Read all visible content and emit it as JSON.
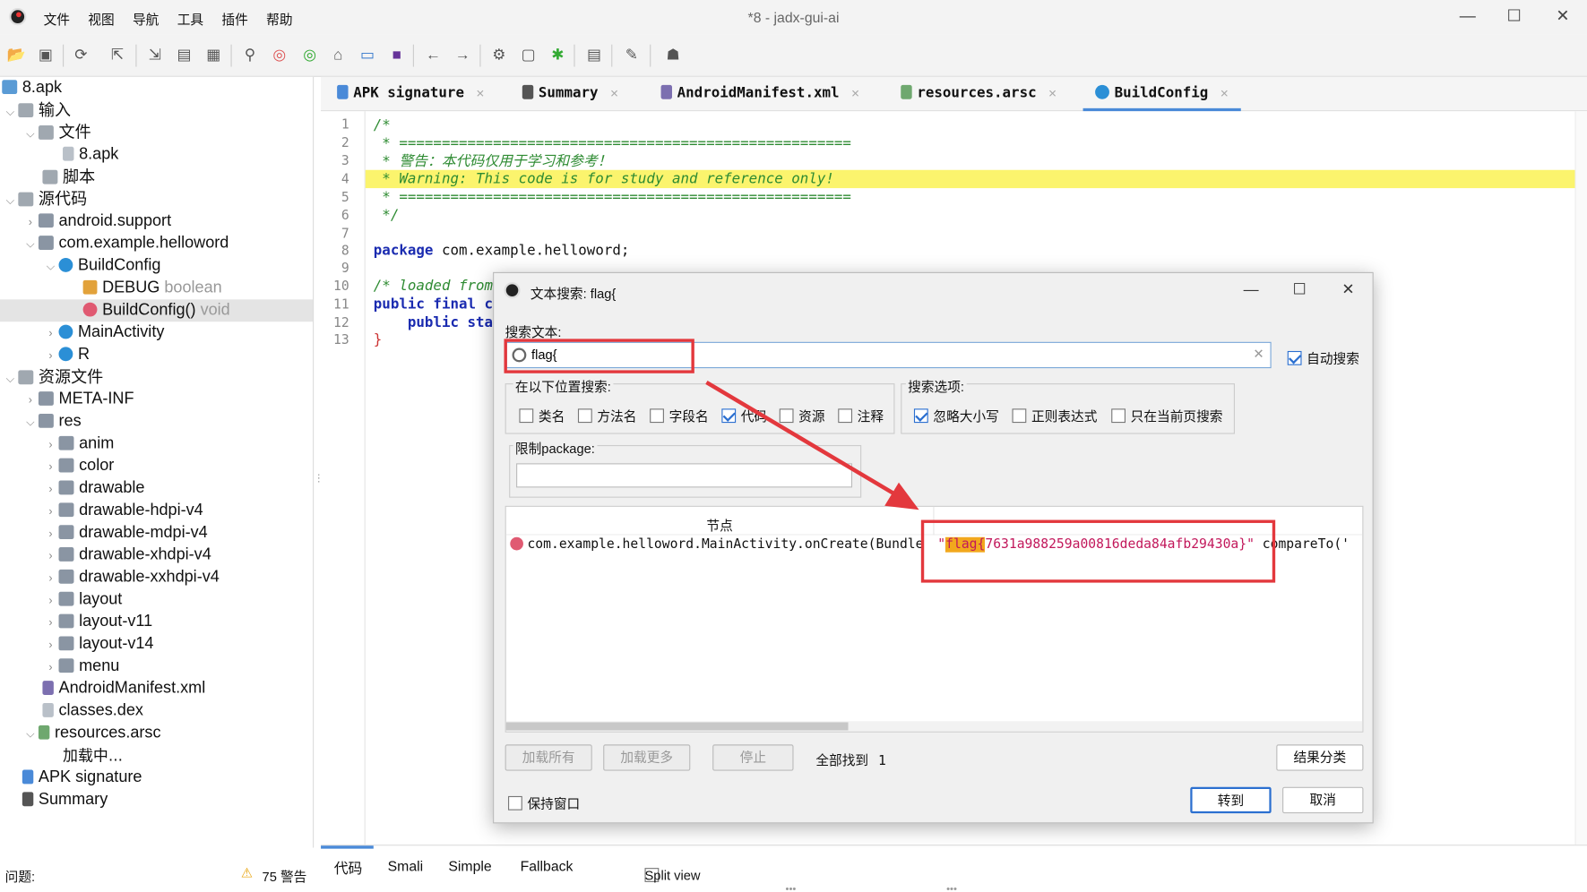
{
  "menu": [
    "文件",
    "视图",
    "导航",
    "工具",
    "插件",
    "帮助"
  ],
  "window": {
    "title": "*8 - jadx-gui-ai",
    "minimize": "—",
    "maximize": "☐",
    "close": "✕"
  },
  "toolbar_icons": [
    "open-file-icon",
    "add-file-icon",
    "reload-icon",
    "export-icon",
    "sync-icon",
    "flatten-icon",
    "decompile-all-icon",
    "search-icon",
    "find-class-icon",
    "find-usage-icon",
    "home-icon",
    "log-icon",
    "kotlin-icon",
    "back-icon",
    "forward-icon",
    "deobfuscate-icon",
    "quick-tabs-icon",
    "debug-icon",
    "log-viewer-icon",
    "settings-icon",
    "android-icon"
  ],
  "tree": [
    {
      "label": "8.apk"
    },
    {
      "label": "输入"
    },
    {
      "label": "文件"
    },
    {
      "label": "8.apk"
    },
    {
      "label": "脚本"
    },
    {
      "label": "源代码"
    },
    {
      "label": "android.support"
    },
    {
      "label": "com.example.helloword"
    },
    {
      "label": "BuildConfig"
    },
    {
      "label": "DEBUG",
      "type": "boolean"
    },
    {
      "label": "BuildConfig()",
      "type": "void"
    },
    {
      "label": "MainActivity"
    },
    {
      "label": "R"
    },
    {
      "label": "资源文件"
    },
    {
      "label": "META-INF"
    },
    {
      "label": "res"
    },
    {
      "label": "anim"
    },
    {
      "label": "color"
    },
    {
      "label": "drawable"
    },
    {
      "label": "drawable-hdpi-v4"
    },
    {
      "label": "drawable-mdpi-v4"
    },
    {
      "label": "drawable-xhdpi-v4"
    },
    {
      "label": "drawable-xxhdpi-v4"
    },
    {
      "label": "layout"
    },
    {
      "label": "layout-v11"
    },
    {
      "label": "layout-v14"
    },
    {
      "label": "menu"
    },
    {
      "label": "AndroidManifest.xml"
    },
    {
      "label": "classes.dex"
    },
    {
      "label": "resources.arsc"
    },
    {
      "label": "加载中..."
    },
    {
      "label": "APK signature"
    },
    {
      "label": "Summary"
    }
  ],
  "tabs": [
    {
      "label": "APK signature"
    },
    {
      "label": "Summary"
    },
    {
      "label": "AndroidManifest.xml"
    },
    {
      "label": "resources.arsc"
    },
    {
      "label": "BuildConfig"
    }
  ],
  "tab_close": "✕",
  "code_lines": [
    {
      "n": "1",
      "text": "/*"
    },
    {
      "n": "2",
      "text": " * ====================================================="
    },
    {
      "n": "3",
      "text": " * 警告：本代码仅用于学习和参考！"
    },
    {
      "n": "4",
      "text": " * Warning: This code is for study and reference only!"
    },
    {
      "n": "5",
      "text": " * ====================================================="
    },
    {
      "n": "6",
      "text": " */"
    },
    {
      "n": "7",
      "text": ""
    },
    {
      "n": "8",
      "kw": "package",
      "text": " com.example.helloword;"
    },
    {
      "n": "9",
      "text": ""
    },
    {
      "n": "10",
      "text": "/* loaded from:"
    },
    {
      "n": "11",
      "kw": "public final cl",
      "text": ""
    },
    {
      "n": "12",
      "kw": "    public stat",
      "text": ""
    },
    {
      "n": "13",
      "text": "}"
    }
  ],
  "code_tabs": [
    "代码",
    "Smali",
    "Simple",
    "Fallback"
  ],
  "split_view": "Split view",
  "status": {
    "problems": "问题:",
    "warnings": "75 警告"
  },
  "dialog": {
    "title": "文本搜索: flag{",
    "search_label": "搜索文本:",
    "search_value": "flag{",
    "auto_search": "自动搜索",
    "search_in_label": "在以下位置搜索:",
    "search_in": [
      {
        "label": "类名",
        "checked": false
      },
      {
        "label": "方法名",
        "checked": false
      },
      {
        "label": "字段名",
        "checked": false
      },
      {
        "label": "代码",
        "checked": true
      },
      {
        "label": "资源",
        "checked": false
      },
      {
        "label": "注释",
        "checked": false
      }
    ],
    "options_label": "搜索选项:",
    "options": [
      {
        "label": "忽略大小写",
        "checked": true
      },
      {
        "label": "正则表达式",
        "checked": false
      },
      {
        "label": "只在当前页搜索",
        "checked": false
      }
    ],
    "package_label": "限制package:",
    "results_header": "节点",
    "result": {
      "node": "com.example.helloword.MainActivity.onCreate(Bundle",
      "quote_open": "\"",
      "match": "flag{",
      "rest": "7631a988259a00816deda84afb29430a}",
      "quote_close": "\"",
      "after": " compareTo('"
    },
    "buttons": {
      "load_all": "加载所有",
      "load_more": "加载更多",
      "stop": "停止",
      "sort": "结果分类",
      "goto": "转到",
      "cancel": "取消"
    },
    "found_label": "全部找到",
    "found_count": "1",
    "keep_window": "保持窗口"
  },
  "colors": {
    "annotation_red": "#e3383d",
    "accent_blue": "#4a8ad8",
    "comment_green": "#2e8b32",
    "keyword_blue": "#1a2bb0",
    "string_pink": "#c2185b",
    "line_highlight": "#fbf46d",
    "match_highlight": "#f2a81d"
  }
}
